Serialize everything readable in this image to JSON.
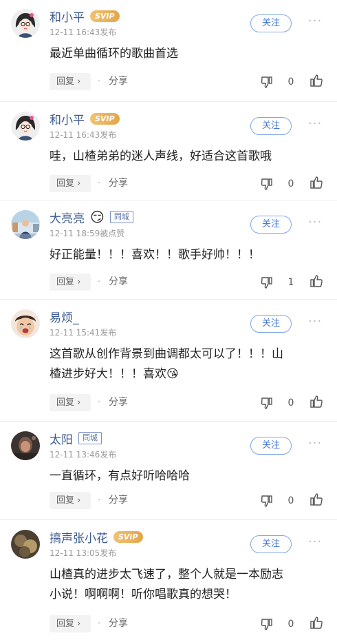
{
  "ui": {
    "follow_label": "关注",
    "reply_label": "回复 ›",
    "separator": "·",
    "share_label": "分享",
    "more_label": "···"
  },
  "colors": {
    "username": "#3b5a8f",
    "follow_border": "#7ea6e6",
    "follow_text": "#4378d6",
    "svip_badge": "#e9b45c"
  },
  "comments": [
    {
      "user": "和小平",
      "badge": "SVIP",
      "badge_type": "svip",
      "time": "12-11 16:43发布",
      "text": "最近单曲循环的歌曲首选",
      "likes": "0",
      "avatar": "avatar-icon-cartoon-girl"
    },
    {
      "user": "和小平",
      "badge": "SVIP",
      "badge_type": "svip",
      "time": "12-11 16:43发布",
      "text": "哇，山楂弟弟的迷人声线，好适合这首歌哦",
      "likes": "0",
      "avatar": "avatar-icon-cartoon-girl"
    },
    {
      "user": "大亮亮",
      "emoji": "😏",
      "badge": "同城",
      "badge_type": "city",
      "time": "12-11 18:59被点赞",
      "text": "好正能量！！！喜欢！！歌手好帅！！！",
      "likes": "1",
      "avatar": "avatar-icon-photo-person"
    },
    {
      "user": "易烦_",
      "time": "12-11 15:41发布",
      "text_lines": [
        "这首歌从创作背景到曲调都太可以了！！！山",
        "楂进步好大！！！喜欢😘"
      ],
      "likes": "0",
      "avatar": "avatar-icon-crying-baby"
    },
    {
      "user": "太阳",
      "badge": "同城",
      "badge_type": "city",
      "time": "12-11 13:46发布",
      "text": "一直循环，有点好听哈哈哈",
      "likes": "0",
      "avatar": "avatar-icon-dark-photo"
    },
    {
      "user": "搞声张小花",
      "badge": "SVIP",
      "badge_type": "svip",
      "time": "12-11 13:05发布",
      "text_lines": [
        "山楂真的进步太飞速了，整个人就是一本励志",
        "小说！啊啊啊！听你唱歌真的想哭！"
      ],
      "likes": "0",
      "avatar": "avatar-icon-blurry-photo"
    }
  ]
}
